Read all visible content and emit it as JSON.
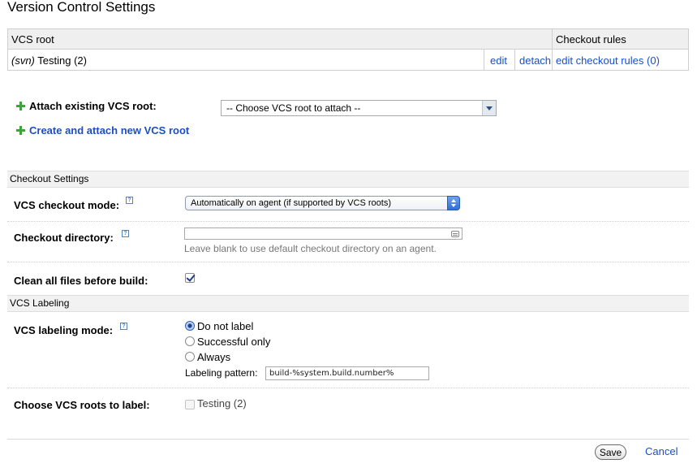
{
  "page": {
    "title": "Version Control Settings"
  },
  "roots_table": {
    "headers": {
      "vcs_root": "VCS root",
      "checkout_rules": "Checkout rules"
    },
    "rows": [
      {
        "type": "(svn)",
        "name": "Testing (2)",
        "edit": "edit",
        "detach": "detach",
        "rules": "edit checkout rules (0)"
      }
    ]
  },
  "attach": {
    "label": "Attach existing VCS root:",
    "select_value": "-- Choose VCS root to attach --",
    "create_link": "Create and attach new VCS root"
  },
  "checkout_settings": {
    "section_title": "Checkout Settings",
    "mode_label": "VCS checkout mode:",
    "mode_value": "Automatically on agent (if supported by VCS roots)",
    "dir_label": "Checkout directory:",
    "dir_value": "",
    "dir_hint": "Leave blank to use default checkout directory on an agent.",
    "clean_label": "Clean all files before build:",
    "clean_checked": true
  },
  "labeling": {
    "section_title": "VCS Labeling",
    "mode_label": "VCS labeling mode:",
    "options": [
      "Do not label",
      "Successful only",
      "Always"
    ],
    "selected": "Do not label",
    "pattern_label": "Labeling pattern:",
    "pattern_value": "build-%system.build.number%",
    "roots_label": "Choose VCS roots to label:",
    "roots": [
      {
        "name": "Testing (2)",
        "checked": false,
        "disabled": true
      }
    ]
  },
  "footer": {
    "save": "Save",
    "cancel": "Cancel"
  },
  "icons": {
    "help": "?",
    "add": "plus-icon"
  },
  "colors": {
    "link": "#1a4fc2",
    "add_icon": "#3aa63a",
    "section_bg": "#f2f2f2"
  }
}
